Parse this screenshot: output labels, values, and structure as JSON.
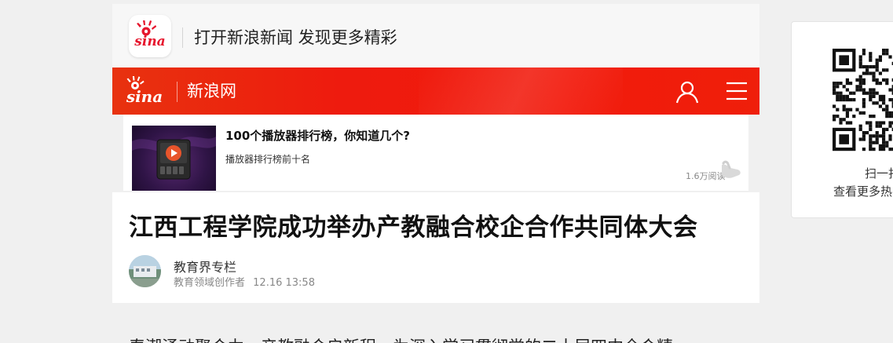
{
  "app_banner": {
    "logo_icon": "sina-eye-logo-icon",
    "text": "打开新浪新闻 发现更多精彩"
  },
  "header": {
    "logo_icon": "sina-logo-icon",
    "site_name": "新浪网",
    "user_icon": "user-icon",
    "menu_icon": "menu-icon",
    "color": "#f21a0c"
  },
  "ad": {
    "thumbnail_icon": "video-player-icon",
    "title": "100个播放器排行榜，你知道几个?",
    "subtitle": "播放器排行榜前十名",
    "reads": "1.6万阅读",
    "hand_icon": "tap-hand-icon"
  },
  "article": {
    "title": "江西工程学院成功举办产教融合校企合作共同体大会",
    "author": {
      "name": "教育界专栏",
      "role": "教育领域创作者",
      "date": "12.16 13:58"
    },
    "body_first_line": "春潮涌动聚合力，产教融合启新程。为深入学习贯彻党的二十届四中全会精"
  },
  "sidebar_qr": {
    "scan_text": "扫一扫",
    "more_text": "查看更多热点"
  }
}
